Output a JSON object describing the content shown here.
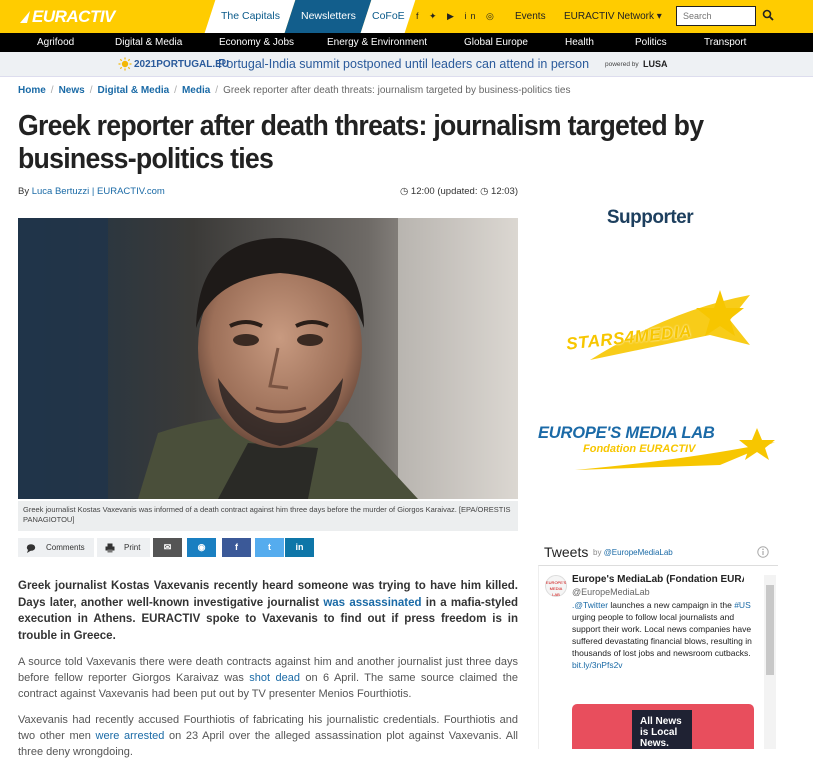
{
  "header": {
    "logo": "EURACTIV",
    "tabs": [
      "The Capitals",
      "Newsletters",
      "CoFoE"
    ],
    "socials": "f  ✦  ▶  in  ◎",
    "events": "Events",
    "network": "EURACTIV Network ▾",
    "search_placeholder": "Search"
  },
  "nav": [
    "Agrifood",
    "Digital & Media",
    "Economy & Jobs",
    "Energy & Environment",
    "Global Europe",
    "Health",
    "Politics",
    "Transport"
  ],
  "promo": {
    "brand": "2021PORTUGAL.EU",
    "text": "Portugal-India summit postponed until leaders can attend in person",
    "powered": "powered by",
    "partner": "LUSA"
  },
  "breadcrumb": [
    "Home",
    "News",
    "Digital & Media",
    "Media",
    "Greek reporter after death threats: journalism targeted by business-politics ties"
  ],
  "article": {
    "title": "Greek reporter after death threats: journalism targeted by business-politics ties",
    "by": "By",
    "author": "Luca Bertuzzi | EURACTIV.com",
    "time": "◷ 12:00 (updated: ◷ 12:03)",
    "caption": "Greek journalist Kostas Vaxevanis was informed of a death contract against him three days before the murder of Giorgos Karaivaz. [EPA/ORESTIS PANAGIOTOU]",
    "share": {
      "comments": "Comments",
      "print": "Print",
      "email": "✉",
      "messenger": "◉",
      "facebook": "f",
      "twitter": "t",
      "linkedin": "in"
    },
    "lead_a": "Greek journalist Kostas Vaxevanis recently heard someone was trying to have him killed. Days later, another well-known investigative journalist ",
    "lead_link": "was assassinated",
    "lead_b": " in a mafia-styled execution in Athens. EURACTIV spoke to Vaxevanis to find out if press freedom is in trouble in Greece.",
    "p1_a": "A source told Vaxevanis there were death contracts against him and another journalist just three days before fellow reporter Giorgos Karaivaz was ",
    "p1_link": "shot dead",
    "p1_b": " on 6 April. The same source claimed the contract against Vaxevanis had been put out by TV presenter Menios Fourthiotis.",
    "p2_a": "Vaxevanis had recently accused Fourthiotis of fabricating his journalistic credentials. Fourthiotis and two other men ",
    "p2_link": "were arrested",
    "p2_b": " on 23 April over the alleged assassination plot against Vaxevanis. All three deny wrongdoing."
  },
  "sidebar": {
    "supporter": "Supporter",
    "stars": "STARS4MEDIA",
    "medialab_1": "EUROPE'S MEDIA LAB",
    "medialab_2": "Fondation EURACTIV",
    "tweets": "Tweets",
    "tweets_by": "by",
    "tweets_handle": "@EuropeMediaLab",
    "tweet": {
      "name": "Europe's MediaLab (Fondation EURACTIV)",
      "handle": "@EuropeMediaLab",
      "mention": ".@Twitter",
      "t1": " launches a new campaign in the ",
      "hashtag": "#US",
      "t2": " urging people to follow local journalists and support their work. Local news companies have suffered devastating financial blows, resulting in thousands of lost jobs and newsroom cutbacks.",
      "link": "bit.ly/3nPfs2v",
      "image_text": "All News is Local News."
    }
  },
  "colors": {
    "brand_yellow": "#ffcc00",
    "brand_blue": "#125e8c",
    "link_blue": "#1a6aa6",
    "facebook": "#3b5998",
    "twitter": "#55acee",
    "linkedin": "#0e76a8"
  }
}
